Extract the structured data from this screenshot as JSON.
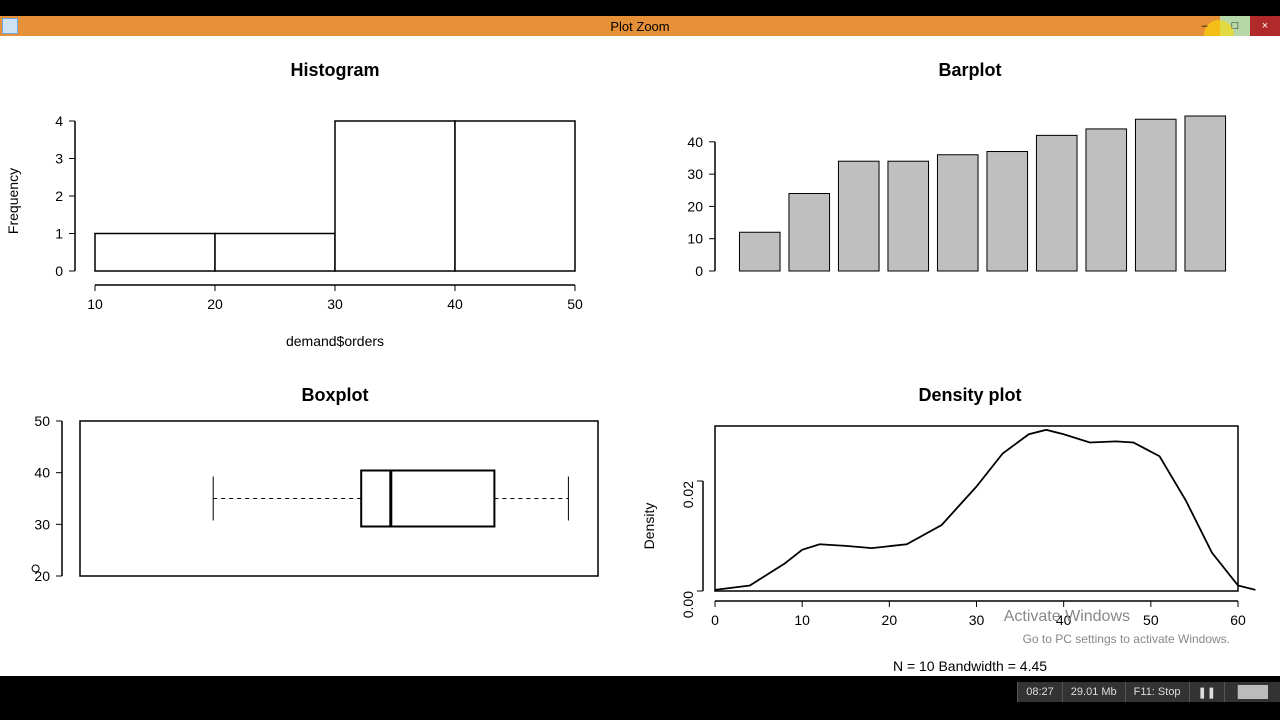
{
  "window": {
    "title": "Plot Zoom",
    "controls": {
      "min": "–",
      "max": "□",
      "close": "×"
    }
  },
  "watermark": {
    "line1": "Activate Windows",
    "line2": "Go to PC settings to activate Windows."
  },
  "statusbar": {
    "time": "08:27",
    "mem": "29.01 Mb",
    "stop": "F11: Stop"
  },
  "chart_data": [
    {
      "type": "bar",
      "title": "Histogram",
      "xlabel": "demand$orders",
      "ylabel": "Frequency",
      "breaks": [
        10,
        20,
        30,
        40,
        50
      ],
      "counts": [
        1,
        1,
        4,
        4
      ],
      "xlim": [
        10,
        50
      ],
      "ylim": [
        0,
        4
      ],
      "yticks": [
        0,
        1,
        2,
        3,
        4
      ]
    },
    {
      "type": "bar",
      "title": "Barplot",
      "values": [
        12,
        24,
        34,
        34,
        36,
        37,
        42,
        44,
        47,
        48
      ],
      "ylim": [
        0,
        40
      ],
      "yticks": [
        0,
        10,
        20,
        30,
        40
      ]
    },
    {
      "type": "boxplot",
      "title": "Boxplot",
      "stats": {
        "min_whisker": 24,
        "q1": 34,
        "median": 36,
        "q3": 43,
        "max_whisker": 48,
        "outliers": [
          12
        ]
      },
      "ylim": [
        15,
        50
      ],
      "yticks": [
        20,
        30,
        40,
        50
      ]
    },
    {
      "type": "density",
      "title": "Density plot",
      "xlabel": "N = 10   Bandwidth = 4.45",
      "ylabel": "Density",
      "xlim": [
        0,
        60
      ],
      "ylim": [
        0,
        0.03
      ],
      "xticks": [
        0,
        10,
        20,
        30,
        40,
        50,
        60
      ],
      "yticks": [
        0.0,
        0.02
      ],
      "points": [
        [
          0,
          0.0002
        ],
        [
          4,
          0.001
        ],
        [
          8,
          0.005
        ],
        [
          10,
          0.0075
        ],
        [
          12,
          0.0085
        ],
        [
          15,
          0.0082
        ],
        [
          18,
          0.0078
        ],
        [
          22,
          0.0085
        ],
        [
          26,
          0.012
        ],
        [
          30,
          0.019
        ],
        [
          33,
          0.025
        ],
        [
          36,
          0.0285
        ],
        [
          38,
          0.0293
        ],
        [
          40,
          0.0285
        ],
        [
          43,
          0.027
        ],
        [
          46,
          0.0272
        ],
        [
          48,
          0.027
        ],
        [
          51,
          0.0245
        ],
        [
          54,
          0.0165
        ],
        [
          57,
          0.007
        ],
        [
          60,
          0.001
        ],
        [
          62,
          0.0002
        ]
      ]
    }
  ]
}
